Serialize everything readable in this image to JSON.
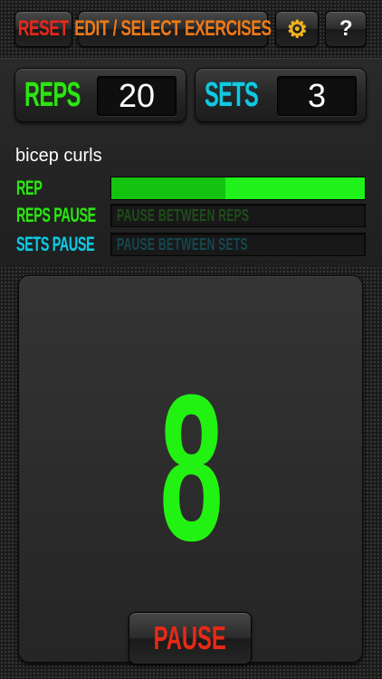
{
  "toolbar": {
    "reset_label": "RESET",
    "edit_label": "EDIT / SELECT EXERCISES",
    "settings_icon": "⚙",
    "help_label": "?"
  },
  "counters": {
    "reps_label": "REPS",
    "reps_value": "20",
    "sets_label": "SETS",
    "sets_value": "3"
  },
  "exercise": {
    "name": "bicep curls"
  },
  "progress": {
    "rep": {
      "label": "REP",
      "fill": 1.0,
      "dark_fill": 0.45
    },
    "reps_pause": {
      "label": "REPS PAUSE",
      "text": "PAUSE BETWEEN REPS",
      "fill": 0
    },
    "sets_pause": {
      "label": "SETS PAUSE",
      "text": "PAUSE BETWEEN SETS",
      "fill": 0
    }
  },
  "display": {
    "current_count": "8"
  },
  "controls": {
    "pause_label": "PAUSE"
  },
  "colors": {
    "green": "#2ee414",
    "cyan": "#12c9e0",
    "red": "#e8281c",
    "orange": "#f07a16",
    "gear": "#f2b21c",
    "digit": "#22f211"
  }
}
